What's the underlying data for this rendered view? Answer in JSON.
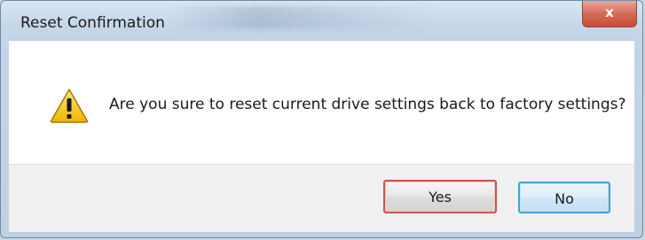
{
  "dialog": {
    "title": "Reset Confirmation",
    "close_glyph": "x",
    "icon": "warning-icon",
    "message": "Are you sure to reset current drive settings back to factory settings?",
    "buttons": {
      "yes_label": "Yes",
      "no_label": "No"
    }
  },
  "colors": {
    "title_bar": "#c4d5e8",
    "close_button": "#d66a57",
    "warning_fill": "#f5c518",
    "yes_border": "#c9544d",
    "no_border": "#4a9fd8"
  }
}
